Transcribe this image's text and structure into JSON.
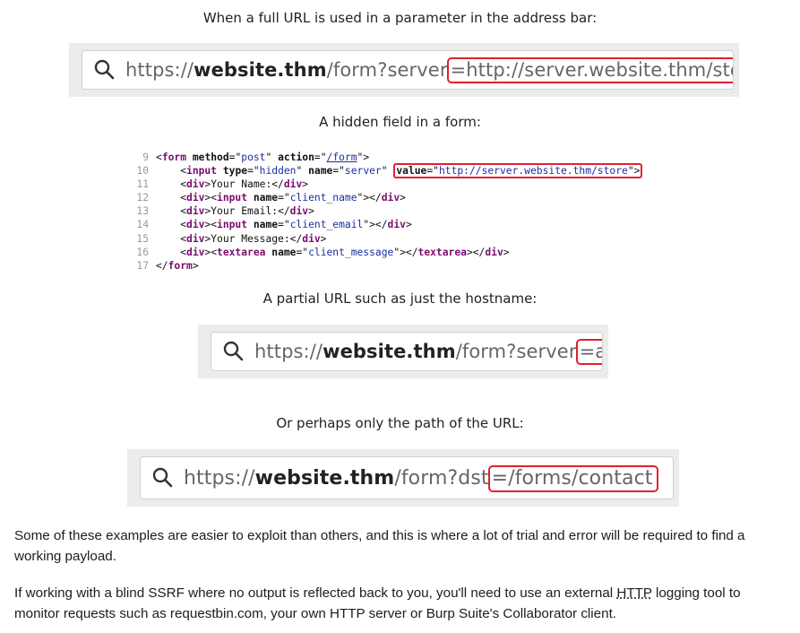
{
  "captions": {
    "full_url": "When a full URL is used in a parameter in the address bar:",
    "hidden_field": "A hidden field in a form:",
    "partial_url": "A partial URL such as just the hostname:",
    "path_only": "Or perhaps only the path of the URL:"
  },
  "url1": {
    "scheme": "https://",
    "host": "website.thm",
    "path": "/form?server",
    "highlight": "=http://server.website.thm/store"
  },
  "url2": {
    "scheme": "https://",
    "host": "website.thm",
    "path": "/form?server",
    "highlight": "=api"
  },
  "url3": {
    "scheme": "https://",
    "host": "website.thm",
    "path": "/form?dst",
    "highlight": "=/forms/contact"
  },
  "code": {
    "lines": [
      "9",
      "10",
      "11",
      "12",
      "13",
      "14",
      "15",
      "16",
      "17"
    ],
    "form_action": "/form",
    "form_method": "post",
    "hidden_name": "server",
    "hidden_value": "http://server.website.thm/store",
    "text_your_name": "Your Name:",
    "text_your_email": "Your Email:",
    "text_your_message": "Your Message:",
    "input_client_name": "client_name",
    "input_client_email": "client_email",
    "textarea_client_message": "client_message"
  },
  "paragraphs": {
    "p1": "Some of these examples are easier to exploit than others, and this is where a lot of trial and error will be required to find a working payload.",
    "p2_before": "If working with a blind SSRF where no output is reflected back to you, you'll need to use an external ",
    "p2_abbr": "HTTP",
    "p2_after": " logging tool to monitor requests such as requestbin.com, your own HTTP server or Burp Suite's Collaborator client."
  }
}
